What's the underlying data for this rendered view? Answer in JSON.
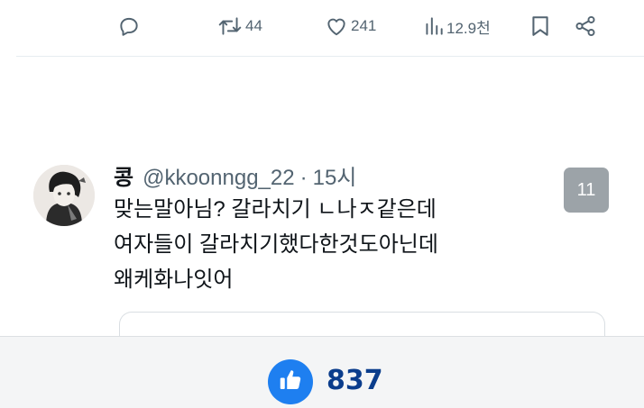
{
  "tweet_actions": {
    "retweet_count": "44",
    "like_count": "241",
    "view_count": "12.9천"
  },
  "reply": {
    "display_name": "콩",
    "handle": "@kkoonngg_22",
    "separator": "·",
    "time": "15시",
    "lines": [
      "맞는말아님? 갈라치기 ㄴ나ㅈ같은데",
      "여자들이 갈라치기했다한것도아닌데",
      "왜케화나잇어"
    ],
    "badge": "11"
  },
  "recommend_bar": {
    "count": "837",
    "accent_color": "#1e7ff0",
    "count_color": "#0b3d8c"
  },
  "icons": [
    "reply-icon",
    "retweet-icon",
    "heart-icon",
    "views-icon",
    "bookmark-icon",
    "share-icon",
    "thumbs-up-icon"
  ]
}
